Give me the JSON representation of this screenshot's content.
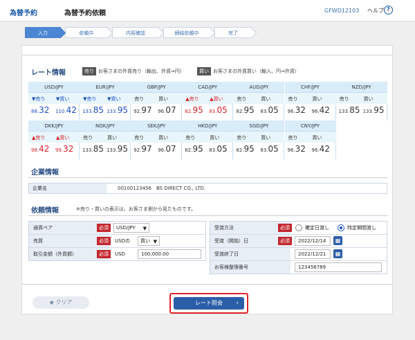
{
  "header": {
    "logo": "為替予約",
    "title": "為替予約依頼",
    "screen_id": "GFWD12103",
    "help": "ヘルプ",
    "help_icon": "?"
  },
  "steps": [
    "入力",
    "依頼中",
    "内容確認",
    "締結依頼中",
    "完了"
  ],
  "rate_info": {
    "title": "レート情報",
    "sell_badge": "売り",
    "sell_text": "お客さまの外貨売り（輸出、外貨⇒円）",
    "buy_badge": "買い",
    "buy_text": "お客さまの外貨買い（輸入、円⇒外貨）",
    "rates": [
      {
        "pair": "USD/JPY",
        "sell_label": "▼売り",
        "buy_label": "▼買い",
        "sell_small": "88.",
        "sell_big": "32",
        "buy_small": "110.",
        "buy_big": "42",
        "sell_color": "#1a4fc4",
        "buy_color": "#1a4fc4"
      },
      {
        "pair": "EUR/JPY",
        "sell_label": "▼売り",
        "buy_label": "▼買い",
        "sell_small": "133.",
        "sell_big": "85",
        "buy_small": "133.",
        "buy_big": "95",
        "sell_color": "#1a4fc4",
        "buy_color": "#1a4fc4"
      },
      {
        "pair": "GBP/JPY",
        "sell_label": "売り",
        "buy_label": "買い",
        "sell_small": "92.",
        "sell_big": "97",
        "buy_small": "96.",
        "buy_big": "07",
        "sell_color": "#333333",
        "buy_color": "#333333"
      },
      {
        "pair": "CAD/JPY",
        "sell_label": "▲売り",
        "buy_label": "▲買い",
        "sell_small": "82.",
        "sell_big": "95",
        "buy_small": "83.",
        "buy_big": "05",
        "sell_color": "#d8202a",
        "buy_color": "#d8202a"
      },
      {
        "pair": "AUD/JPY",
        "sell_label": "売り",
        "buy_label": "買い",
        "sell_small": "82.",
        "sell_big": "95",
        "buy_small": "83.",
        "buy_big": "05",
        "sell_color": "#333333",
        "buy_color": "#333333"
      },
      {
        "pair": "CHF/JPY",
        "sell_label": "売り",
        "buy_label": "買い",
        "sell_small": "96.",
        "sell_big": "32",
        "buy_small": "96.",
        "buy_big": "42",
        "sell_color": "#333333",
        "buy_color": "#333333"
      },
      {
        "pair": "NZD/JPY",
        "sell_label": "売り",
        "buy_label": "買い",
        "sell_small": "133.",
        "sell_big": "85",
        "buy_small": "133.",
        "buy_big": "95",
        "sell_color": "#333333",
        "buy_color": "#333333"
      },
      {
        "pair": "DKK/JPY",
        "sell_label": "▲売り",
        "buy_label": "▲買い",
        "sell_small": "98.",
        "sell_big": "42",
        "buy_small": "99.",
        "buy_big": "32",
        "sell_color": "#d8202a",
        "buy_color": "#d8202a"
      },
      {
        "pair": "NOK/JPY",
        "sell_label": "売り",
        "buy_label": "買い",
        "sell_small": "133.",
        "sell_big": "85",
        "buy_small": "133.",
        "buy_big": "95",
        "sell_color": "#333333",
        "buy_color": "#333333"
      },
      {
        "pair": "SEK/JPY",
        "sell_label": "売り",
        "buy_label": "買い",
        "sell_small": "92.",
        "sell_big": "97",
        "buy_small": "96.",
        "buy_big": "07",
        "sell_color": "#333333",
        "buy_color": "#333333"
      },
      {
        "pair": "HKD/JPY",
        "sell_label": "売り",
        "buy_label": "買い",
        "sell_small": "82.",
        "sell_big": "95",
        "buy_small": "83.",
        "buy_big": "05",
        "sell_color": "#333333",
        "buy_color": "#333333"
      },
      {
        "pair": "SGD/JPY",
        "sell_label": "売り",
        "buy_label": "買い",
        "sell_small": "82.",
        "sell_big": "95",
        "buy_small": "83.",
        "buy_big": "05",
        "sell_color": "#333333",
        "buy_color": "#333333"
      },
      {
        "pair": "CNY/JPY",
        "sell_label": "売り",
        "buy_label": "買い",
        "sell_small": "96.",
        "sell_big": "32",
        "buy_small": "96.",
        "buy_big": "42",
        "sell_color": "#333333",
        "buy_color": "#333333"
      }
    ]
  },
  "company": {
    "title": "企業情報",
    "label": "企業名",
    "value": "00100123456　BS DIRECT CO., LTD."
  },
  "request": {
    "title": "依頼情報",
    "note": "※売り・買いの表示は、お客さま側から見たものです。",
    "required": "必須",
    "pair_label": "通貨ペア",
    "pair_value": "USD/JPY",
    "trade_label": "売買",
    "trade_prefix": "USDの",
    "trade_value": "買い",
    "amount_label": "取引金額（外貨額）",
    "amount_currency": "USD",
    "amount_value": "100,000.00",
    "delivery_label": "受渡方法",
    "delivery_opt1": "確定日渡し",
    "delivery_opt2": "特定期間渡し",
    "start_label": "受渡（開始）日",
    "start_value": "2022/12/14",
    "end_label": "受渡終了日",
    "end_value": "2022/12/21",
    "ref_label": "お客様整理番号",
    "ref_value": "123456789",
    "calendar_icon": "▦"
  },
  "actions": {
    "clear": "クリア",
    "rate_inquiry": "レート照会",
    "chevron": "›"
  }
}
